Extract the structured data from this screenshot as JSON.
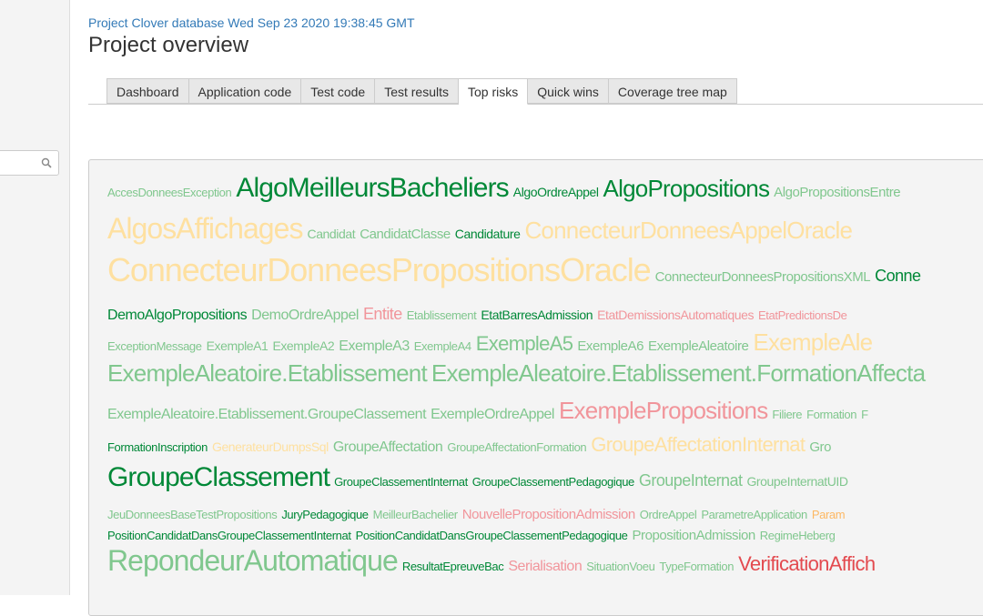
{
  "header": {
    "subtitle": "Project Clover database Wed Sep 23 2020 19:38:45 GMT",
    "title": "Project overview"
  },
  "sidebar": {
    "search_icon": "magnifier-icon",
    "search_value": ""
  },
  "tabs": [
    {
      "label": "Dashboard",
      "active": false
    },
    {
      "label": "Application code",
      "active": false
    },
    {
      "label": "Test code",
      "active": false
    },
    {
      "label": "Test results",
      "active": false
    },
    {
      "label": "Top risks",
      "active": true
    },
    {
      "label": "Quick wins",
      "active": false
    },
    {
      "label": "Coverage tree map",
      "active": false
    }
  ],
  "colors": {
    "dark_green": "#008837",
    "light_green": "#80c78e",
    "light_orange": "#fee0a0",
    "orange": "#fdb863",
    "pink": "#f1959b",
    "red": "#e34a4f",
    "link": "#337ab7"
  },
  "tag_cloud": [
    [
      [
        "AccesDonneesException",
        1,
        "light_green"
      ],
      [
        "AlgoMeilleursBacheliers",
        8,
        "dark_green"
      ],
      [
        "AlgoOrdreAppel",
        2,
        "dark_green"
      ],
      [
        "AlgoPropositions",
        7,
        "dark_green"
      ],
      [
        "AlgoPropositionsEntre",
        3,
        "light_green"
      ]
    ],
    [
      [
        "AlgosAffichages",
        9,
        "light_orange"
      ],
      [
        "Candidat",
        2,
        "light_green"
      ],
      [
        "CandidatClasse",
        3,
        "light_green"
      ],
      [
        "Candidature",
        2,
        "dark_green"
      ],
      [
        "ConnecteurDonneesAppelOracle",
        7,
        "light_orange"
      ]
    ],
    [
      [
        "ConnecteurDonneesPropositionsOracle",
        10,
        "light_orange"
      ],
      [
        "ConnecteurDonneesPropositionsXML",
        3,
        "light_green"
      ],
      [
        "Conne",
        5,
        "dark_green"
      ]
    ],
    [
      [
        "DemoAlgoPropositions",
        4,
        "dark_green"
      ],
      [
        "DemoOrdreAppel",
        4,
        "light_green"
      ],
      [
        "Entite",
        5,
        "pink"
      ],
      [
        "Etablissement",
        1,
        "light_green"
      ],
      [
        "EtatBarresAdmission",
        2,
        "dark_green"
      ],
      [
        "EtatDemissionsAutomatiques",
        2,
        "pink"
      ],
      [
        "EtatPredictionsDe",
        1,
        "pink"
      ]
    ],
    [
      [
        "ExceptionMessage",
        1,
        "light_green"
      ],
      [
        "ExempleA1",
        2,
        "light_green"
      ],
      [
        "ExempleA2",
        2,
        "light_green"
      ],
      [
        "ExempleA3",
        4,
        "light_green"
      ],
      [
        "ExempleA4",
        1,
        "light_green"
      ],
      [
        "ExempleA5",
        6,
        "light_green"
      ],
      [
        "ExempleA6",
        3,
        "light_green"
      ],
      [
        "ExempleAleatoire",
        3,
        "light_green"
      ],
      [
        "ExempleAle",
        7,
        "light_orange"
      ]
    ],
    [
      [
        "ExempleAleatoire.Etablissement",
        7,
        "light_green"
      ],
      [
        "ExempleAleatoire.Etablissement.FormationAffecta",
        7,
        "light_green"
      ]
    ],
    [
      [
        "ExempleAleatoire.Etablissement.GroupeClassement",
        4,
        "light_green"
      ],
      [
        "ExempleOrdreAppel",
        4,
        "light_green"
      ],
      [
        "ExemplePropositions",
        7,
        "pink"
      ],
      [
        "Filiere",
        1,
        "light_green"
      ],
      [
        "Formation",
        1,
        "light_green"
      ],
      [
        "F",
        1,
        "light_green"
      ]
    ],
    [
      [
        "FormationInscription",
        1,
        "dark_green"
      ],
      [
        "GenerateurDumpsSql",
        2,
        "light_orange"
      ],
      [
        "GroupeAffectation",
        4,
        "light_green"
      ],
      [
        "GroupeAffectationFormation",
        1,
        "light_green"
      ],
      [
        "GroupeAffectationInternat",
        6,
        "light_orange"
      ],
      [
        "Gro",
        3,
        "light_green"
      ]
    ],
    [
      [
        "GroupeClassement",
        8,
        "dark_green"
      ],
      [
        "GroupeClassementInternat",
        1,
        "dark_green"
      ],
      [
        "GroupeClassementPedagogique",
        1,
        "dark_green"
      ],
      [
        "GroupeInternat",
        5,
        "light_green"
      ],
      [
        "GroupeInternatUID",
        2,
        "light_green"
      ]
    ],
    [
      [
        "JeuDonneesBaseTestPropositions",
        1,
        "light_green"
      ],
      [
        "JuryPedagogique",
        1,
        "dark_green"
      ],
      [
        "MeilleurBachelier",
        1,
        "light_green"
      ],
      [
        "NouvellePropositionAdmission",
        3,
        "pink"
      ],
      [
        "OrdreAppel",
        1,
        "light_green"
      ],
      [
        "ParametreApplication",
        1,
        "light_green"
      ],
      [
        "Param",
        1,
        "orange"
      ]
    ],
    [
      [
        "PositionCandidatDansGroupeClassementInternat",
        1,
        "dark_green"
      ],
      [
        "PositionCandidatDansGroupeClassementPedagogique",
        1,
        "dark_green"
      ],
      [
        "PropositionAdmission",
        3,
        "light_green"
      ],
      [
        "RegimeHeberg",
        1,
        "light_green"
      ]
    ],
    [
      [
        "RepondeurAutomatique",
        9,
        "light_green"
      ],
      [
        "ResultatEpreuveBac",
        1,
        "dark_green"
      ],
      [
        "Serialisation",
        4,
        "pink"
      ],
      [
        "SituationVoeu",
        1,
        "light_green"
      ],
      [
        "TypeFormation",
        1,
        "light_green"
      ],
      [
        "VerificationAffich",
        6,
        "red"
      ]
    ]
  ]
}
